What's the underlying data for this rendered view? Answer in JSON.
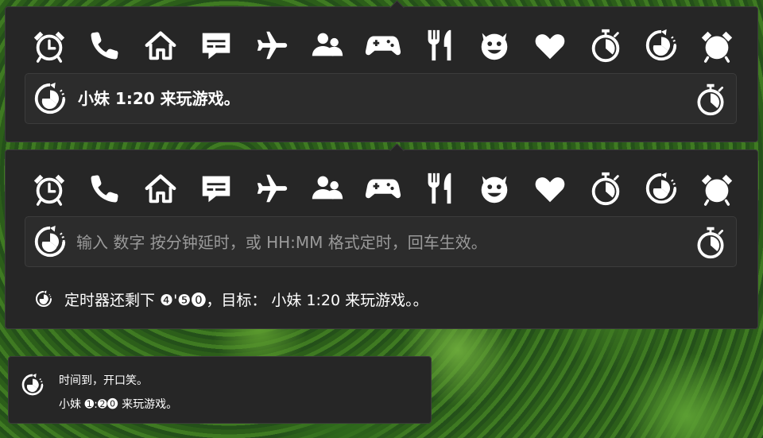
{
  "icon_bar": [
    {
      "name": "alarm-clock-icon"
    },
    {
      "name": "phone-icon"
    },
    {
      "name": "home-icon"
    },
    {
      "name": "message-icon"
    },
    {
      "name": "airplane-icon"
    },
    {
      "name": "people-icon"
    },
    {
      "name": "gamepad-icon"
    },
    {
      "name": "fork-knife-icon"
    },
    {
      "name": "devil-face-icon"
    },
    {
      "name": "heart-icon"
    },
    {
      "name": "stopwatch-icon"
    },
    {
      "name": "timer-refresh-icon"
    },
    {
      "name": "alarm-bell-icon"
    }
  ],
  "panel1": {
    "field_text": "小妹 1:20 来玩游戏。"
  },
  "panel2": {
    "placeholder": "输入 数字 按分钟延时，或 HH:MM 格式定时，回车生效。",
    "status_text": "定时器还剩下 ❹'❺⓿，目标： 小妹 1:20 来玩游戏。。"
  },
  "toast": {
    "title": "时间到，开口笑。",
    "message": "小妹 ➊:➋⓿ 来玩游戏。"
  },
  "colors": {
    "panel_bg": "#262626",
    "field_bg": "#2c2c2c",
    "text": "#ffffff",
    "placeholder": "#9a9a9a"
  }
}
